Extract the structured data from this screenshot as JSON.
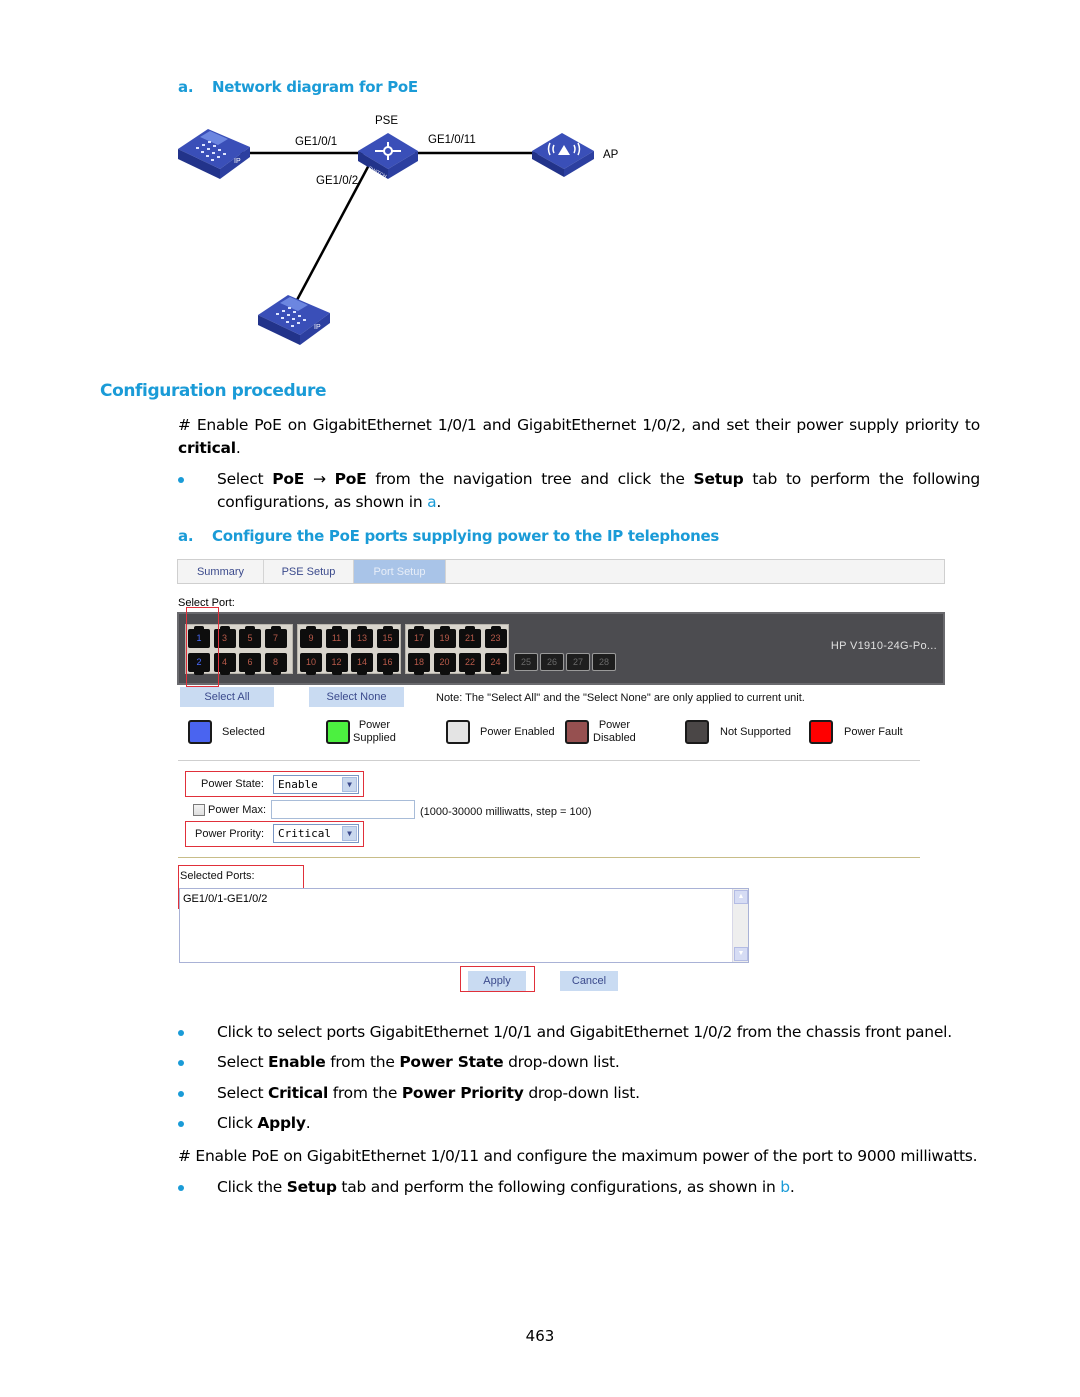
{
  "figure_a": {
    "label": "a.",
    "title": "Network diagram for PoE",
    "nodes": {
      "pse_label": "PSE",
      "ap_label": "AP",
      "switch_text": "SWITCH",
      "phone_text": "IP"
    },
    "links": {
      "port1": "GE1/0/1",
      "port11": "GE1/0/11",
      "port2": "GE1/0/2"
    }
  },
  "section": {
    "heading": "Configuration procedure",
    "para1_pre": "# Enable PoE on GigabitEthernet 1/0/1 and GigabitEthernet 1/0/2, and set their power supply priority to",
    "para1_bold": "critical",
    "para1_post": ".",
    "bullet1": {
      "t1": "Select ",
      "b1": "PoE",
      "arrow": " → ",
      "b2": "PoE",
      "t2": " from the navigation tree and click the ",
      "b3": "Setup",
      "t3": " tab to perform the following",
      "line2": "configurations, as shown in ",
      "ref": "a",
      "end": "."
    }
  },
  "figure_b": {
    "label": "a.",
    "title": "Configure the PoE ports supplying power to the IP telephones"
  },
  "ui": {
    "tabs": [
      {
        "label": "Summary",
        "active": false
      },
      {
        "label": "PSE Setup",
        "active": false
      },
      {
        "label": "Port Setup",
        "active": true
      }
    ],
    "select_port_label": "Select Port:",
    "ports_top": [
      "1",
      "3",
      "5",
      "7",
      "9",
      "11",
      "13",
      "15",
      "17",
      "19",
      "21",
      "23"
    ],
    "ports_bottom": [
      "2",
      "4",
      "6",
      "8",
      "10",
      "12",
      "14",
      "16",
      "18",
      "20",
      "22",
      "24"
    ],
    "ports_sfp": [
      "25",
      "26",
      "27",
      "28"
    ],
    "selected_ports": [
      "1",
      "2"
    ],
    "device_model": "HP V1910-24G-Po...",
    "select_all": "Select All",
    "select_none": "Select None",
    "note": "Note: The \"Select All\" and the \"Select None\" are only applied to current unit.",
    "legend": [
      {
        "label": "Selected",
        "color": "#4a64f0"
      },
      {
        "label": "Power\nSupplied",
        "color": "#4cf040"
      },
      {
        "label": "Power Enabled",
        "color": "#e4e4e4"
      },
      {
        "label": "Power\nDisabled",
        "color": "#965050"
      },
      {
        "label": "Not Supported",
        "color": "#4a4646"
      },
      {
        "label": "Power Fault",
        "color": "#ff0000"
      }
    ],
    "power_state_label": "Power State:",
    "power_state_value": "Enable",
    "power_max_label": "Power Max:",
    "power_max_value": "",
    "power_max_checked": false,
    "power_max_hint": "(1000-30000 milliwatts, step = 100)",
    "power_priority_label": "Power Prority:",
    "power_priority_value": "Critical",
    "selected_ports_label": "Selected Ports:",
    "selected_ports_value": "GE1/0/1-GE1/0/2",
    "apply": "Apply",
    "cancel": "Cancel"
  },
  "steps": [
    {
      "pre": "Click to select ports GigabitEthernet 1/0/1 and GigabitEthernet 1/0/2 from the chassis front panel.",
      "b1": "",
      "mid": "",
      "b2": "",
      "post": ""
    },
    {
      "pre": "Select ",
      "b1": "Enable",
      "mid": " from the ",
      "b2": "Power State",
      "post": " drop-down list."
    },
    {
      "pre": "Select ",
      "b1": "Critical",
      "mid": " from the ",
      "b2": "Power Priority",
      "post": " drop-down list."
    },
    {
      "pre": "Click ",
      "b1": "Apply",
      "mid": ".",
      "b2": "",
      "post": ""
    }
  ],
  "para2": "# Enable PoE on GigabitEthernet 1/0/11 and configure the maximum power of the port to 9000 milliwatts.",
  "last_bullet": {
    "pre": "Click the ",
    "bold": "Setup",
    "post": " tab and perform the following configurations, as shown in ",
    "ref": "b",
    "end": "."
  },
  "page_number": "463"
}
